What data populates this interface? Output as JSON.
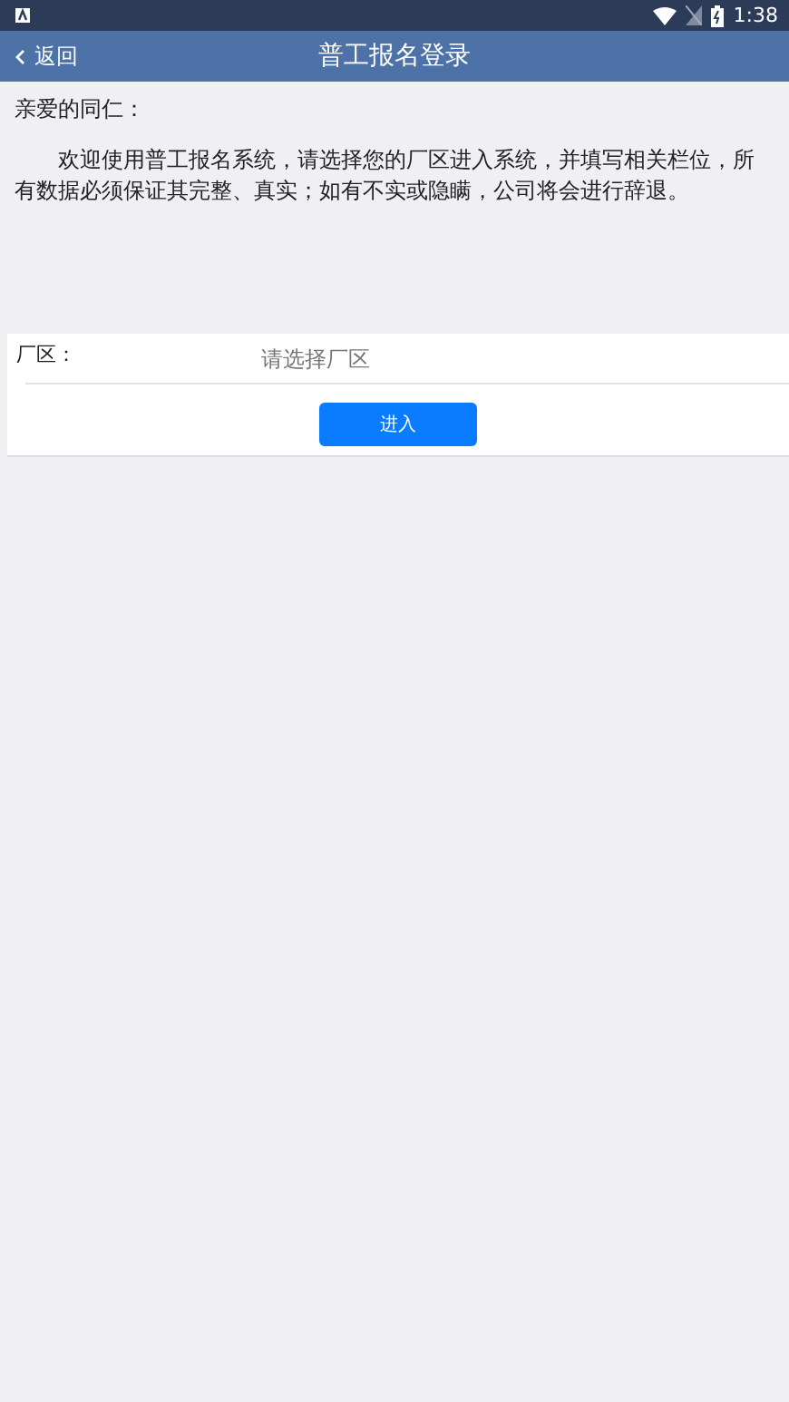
{
  "status_bar": {
    "time": "1:38"
  },
  "header": {
    "back": "返回",
    "title": "普工报名登录"
  },
  "greeting": "亲爱的同仁：",
  "notice": "欢迎使用普工报名系统，请选择您的厂区进入系统，并填写相关栏位，所有数据必须保证其完整、真实；如有不实或隐瞒，公司将会进行辞退。",
  "form": {
    "label": "厂区：",
    "placeholder": "请选择厂区",
    "button": "进入"
  }
}
